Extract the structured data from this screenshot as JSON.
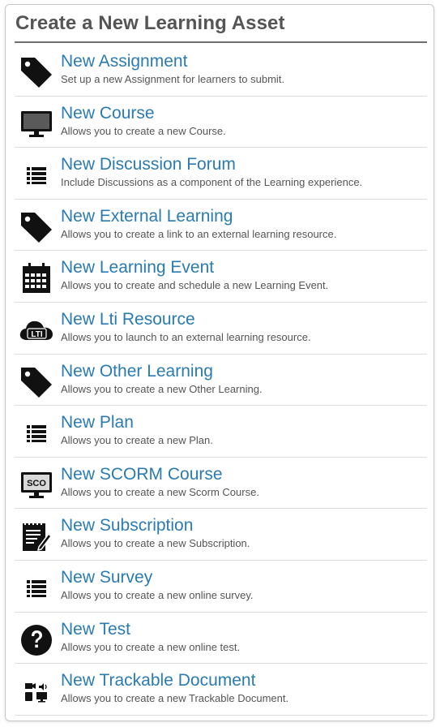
{
  "header": {
    "title": "Create a New Learning Asset"
  },
  "items": [
    {
      "icon": "tag-icon",
      "title": "New Assignment",
      "description": "Set up a new Assignment for learners to submit."
    },
    {
      "icon": "monitor-icon",
      "title": "New Course",
      "description": "Allows you to create a new Course."
    },
    {
      "icon": "list-icon",
      "title": "New Discussion Forum",
      "description": "Include Discussions as a component of the Learning experience."
    },
    {
      "icon": "tag-icon",
      "title": "New External Learning",
      "description": "Allows you to create a link to an external learning resource."
    },
    {
      "icon": "calendar-icon",
      "title": "New Learning Event",
      "description": "Allows you to create and schedule a new Learning Event."
    },
    {
      "icon": "lti-cloud-icon",
      "title": "New Lti Resource",
      "description": "Allows you to launch to an external learning resource.",
      "icon_text": "LTI"
    },
    {
      "icon": "tag-icon",
      "title": "New Other Learning",
      "description": "Allows you to create a new Other Learning."
    },
    {
      "icon": "list-icon",
      "title": "New Plan",
      "description": "Allows you to create a new Plan."
    },
    {
      "icon": "scorm-monitor-icon",
      "title": "New SCORM Course",
      "description": "Allows you to create a new Scorm Course.",
      "icon_text": "SCO"
    },
    {
      "icon": "notepad-pencil-icon",
      "title": "New Subscription",
      "description": "Allows you to create a new Subscription."
    },
    {
      "icon": "list-icon",
      "title": "New Survey",
      "description": "Allows you to create a new online survey."
    },
    {
      "icon": "question-circle-icon",
      "title": "New Test",
      "description": "Allows you to create a new online test."
    },
    {
      "icon": "media-devices-icon",
      "title": "New Trackable Document",
      "description": "Allows you to create a new Trackable Document."
    }
  ]
}
